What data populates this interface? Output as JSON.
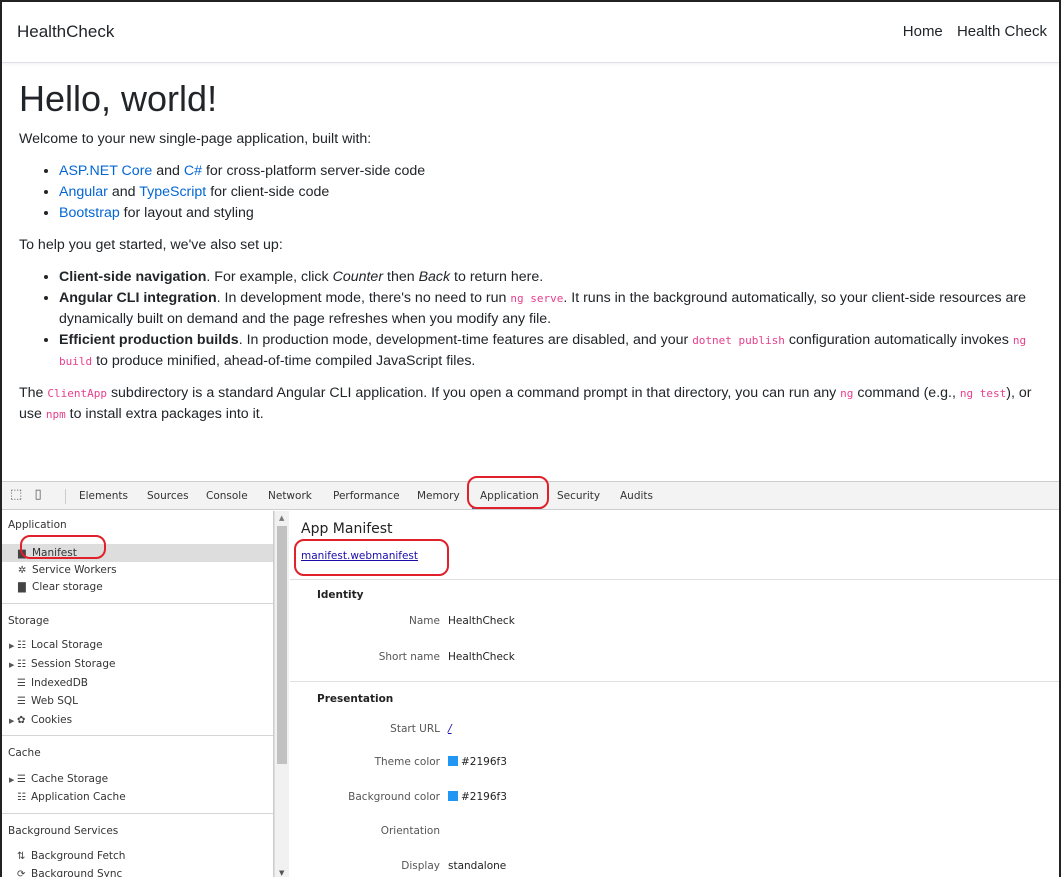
{
  "navbar": {
    "brand": "HealthCheck",
    "links": [
      "Home",
      "Health Check"
    ]
  },
  "page": {
    "heading": "Hello, world!",
    "intro": "Welcome to your new single-page application, built with:",
    "built_with": [
      {
        "link1": "ASP.NET Core",
        "mid": " and ",
        "link2": "C#",
        "rest": " for cross-platform server-side code"
      },
      {
        "link1": "Angular",
        "mid": " and ",
        "link2": "TypeScript",
        "rest": " for client-side code"
      },
      {
        "link1": "Bootstrap",
        "mid": "",
        "link2": "",
        "rest": " for layout and styling"
      }
    ],
    "setup_intro": "To help you get started, we've also set up:",
    "setup": {
      "nav_title": "Client-side navigation",
      "nav_text_1": ". For example, click ",
      "nav_counter": "Counter",
      "nav_text_2": " then ",
      "nav_back": "Back",
      "nav_text_3": " to return here.",
      "cli_title": "Angular CLI integration",
      "cli_text_1": ". In development mode, there's no need to run ",
      "cli_code": "ng serve",
      "cli_text_2": ". It runs in the background automatically, so your client-side resources are dynamically built on demand and the page refreshes when you modify any file.",
      "prod_title": "Efficient production builds",
      "prod_text_1": ". In production mode, development-time features are disabled, and your ",
      "prod_code_1": "dotnet publish",
      "prod_text_2": " configuration automatically invokes ",
      "prod_code_2": "ng build",
      "prod_text_3": " to produce minified, ahead-of-time compiled JavaScript files."
    },
    "footer": {
      "t1": "The ",
      "code1": "ClientApp",
      "t2": " subdirectory is a standard Angular CLI application. If you open a command prompt in that directory, you can run any ",
      "code2": "ng",
      "t3": " command (e.g., ",
      "code3": "ng test",
      "t4": "), or use ",
      "code4": "npm",
      "t5": " to install extra packages into it."
    }
  },
  "devtools": {
    "tabs": [
      "Elements",
      "Sources",
      "Console",
      "Network",
      "Performance",
      "Memory",
      "Application",
      "Security",
      "Audits"
    ],
    "active_tab": "Application",
    "sidebar": {
      "application_header": "Application",
      "application_items": [
        "Manifest",
        "Service Workers",
        "Clear storage"
      ],
      "storage_header": "Storage",
      "storage_items": [
        "Local Storage",
        "Session Storage",
        "IndexedDB",
        "Web SQL",
        "Cookies"
      ],
      "cache_header": "Cache",
      "cache_items": [
        "Cache Storage",
        "Application Cache"
      ],
      "bg_header": "Background Services",
      "bg_items": [
        "Background Fetch",
        "Background Sync"
      ]
    },
    "manifest": {
      "title": "App Manifest",
      "link": "manifest.webmanifest",
      "identity_header": "Identity",
      "name_label": "Name",
      "name_value": "HealthCheck",
      "short_name_label": "Short name",
      "short_name_value": "HealthCheck",
      "presentation_header": "Presentation",
      "start_url_label": "Start URL",
      "start_url_value": "/",
      "theme_color_label": "Theme color",
      "theme_color_value": "#2196f3",
      "bg_color_label": "Background color",
      "bg_color_value": "#2196f3",
      "orientation_label": "Orientation",
      "display_label": "Display",
      "display_value": "standalone"
    }
  },
  "colors": {
    "link": "#0366d6",
    "code": "#e83e8c",
    "highlight_oval": "#e0202a",
    "swatch": "#2196f3"
  }
}
